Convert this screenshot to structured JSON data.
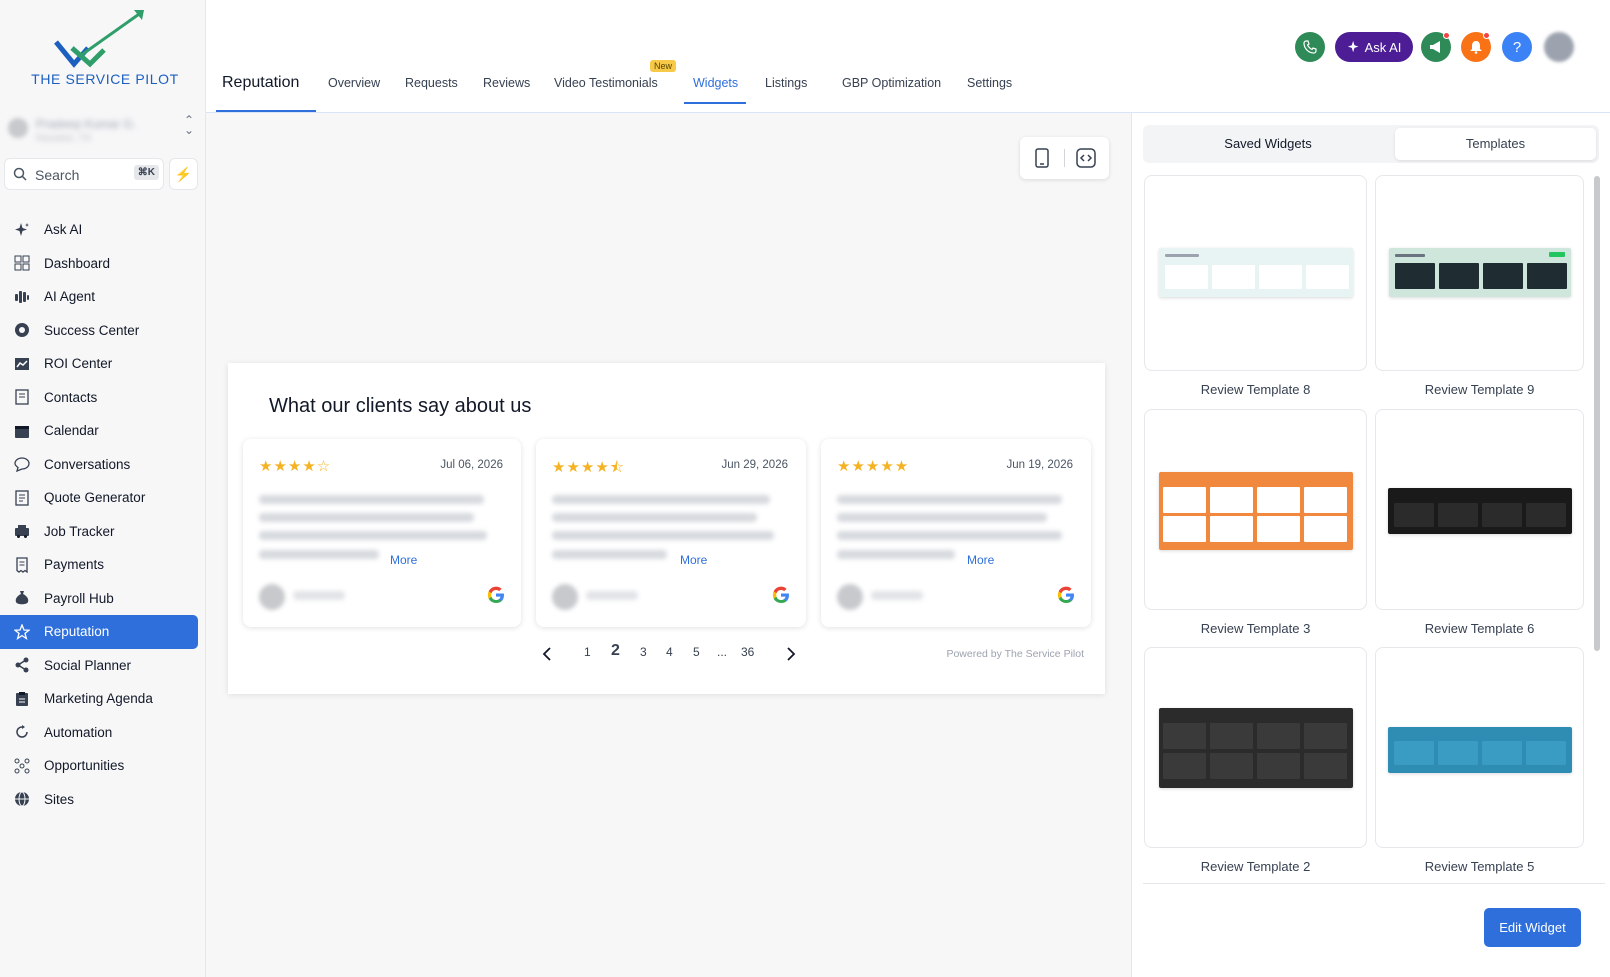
{
  "brand": {
    "name": "THE SERVICE PILOT"
  },
  "account": {
    "name": "Pradeep Kumar G.",
    "location": "Houston, TX"
  },
  "search": {
    "placeholder": "Search",
    "shortcut": "⌘K"
  },
  "sidebar": {
    "items": [
      {
        "label": "Ask AI",
        "icon": "sparkles-icon"
      },
      {
        "label": "Dashboard",
        "icon": "grid-icon"
      },
      {
        "label": "AI Agent",
        "icon": "voice-wave-icon"
      },
      {
        "label": "Success Center",
        "icon": "lifebuoy-icon"
      },
      {
        "label": "ROI Center",
        "icon": "chart-icon"
      },
      {
        "label": "Contacts",
        "icon": "address-book-icon"
      },
      {
        "label": "Calendar",
        "icon": "calendar-icon"
      },
      {
        "label": "Conversations",
        "icon": "chat-bubble-icon"
      },
      {
        "label": "Quote Generator",
        "icon": "document-icon"
      },
      {
        "label": "Job Tracker",
        "icon": "truck-icon"
      },
      {
        "label": "Payments",
        "icon": "receipt-icon"
      },
      {
        "label": "Payroll Hub",
        "icon": "money-bag-icon"
      },
      {
        "label": "Reputation",
        "icon": "star-icon",
        "active": true
      },
      {
        "label": "Social Planner",
        "icon": "share-icon"
      },
      {
        "label": "Marketing Agenda",
        "icon": "clipboard-icon"
      },
      {
        "label": "Automation",
        "icon": "automation-icon"
      },
      {
        "label": "Opportunities",
        "icon": "funnel-icon"
      },
      {
        "label": "Sites",
        "icon": "globe-icon"
      }
    ]
  },
  "header": {
    "title": "Reputation",
    "tabs": [
      {
        "label": "Overview"
      },
      {
        "label": "Requests"
      },
      {
        "label": "Reviews"
      },
      {
        "label": "Video Testimonials",
        "badge": "New"
      },
      {
        "label": "Widgets",
        "active": true
      },
      {
        "label": "Listings"
      },
      {
        "label": "GBP Optimization"
      },
      {
        "label": "Settings"
      }
    ],
    "ask_ai_label": "Ask AI",
    "help_label": "?"
  },
  "widget": {
    "title": "What our clients say about us",
    "reviews": [
      {
        "stars": "★★★★☆",
        "rating": 4,
        "date": "Jul 06, 2026",
        "more": "More"
      },
      {
        "stars": "★★★★⯪",
        "rating": 4.5,
        "date": "Jun 29, 2026",
        "more": "More"
      },
      {
        "stars": "★★★★★",
        "rating": 5,
        "date": "Jun 19, 2026",
        "more": "More"
      }
    ],
    "pagination": {
      "pages": [
        "1",
        "2",
        "3",
        "4",
        "5",
        "...",
        "36"
      ],
      "current": "2"
    },
    "powered_by": "Powered by The Service Pilot"
  },
  "panel": {
    "tabs": {
      "saved": "Saved Widgets",
      "templates": "Templates"
    },
    "templates": [
      {
        "label": "Review Template 8",
        "theme": "#e8f4f3"
      },
      {
        "label": "Review Template 9",
        "theme": "#cfe6dc"
      },
      {
        "label": "Review Template 3",
        "theme": "#f0883e"
      },
      {
        "label": "Review Template 6",
        "theme": "#1a1a1a"
      },
      {
        "label": "Review Template 2",
        "theme": "#2b2b2b"
      },
      {
        "label": "Review Template 5",
        "theme": "#2f8db3"
      }
    ],
    "edit_button": "Edit Widget"
  },
  "colors": {
    "accent": "#2f6fdc",
    "star": "#f5b324",
    "ask_ai": "#4c1d95"
  }
}
